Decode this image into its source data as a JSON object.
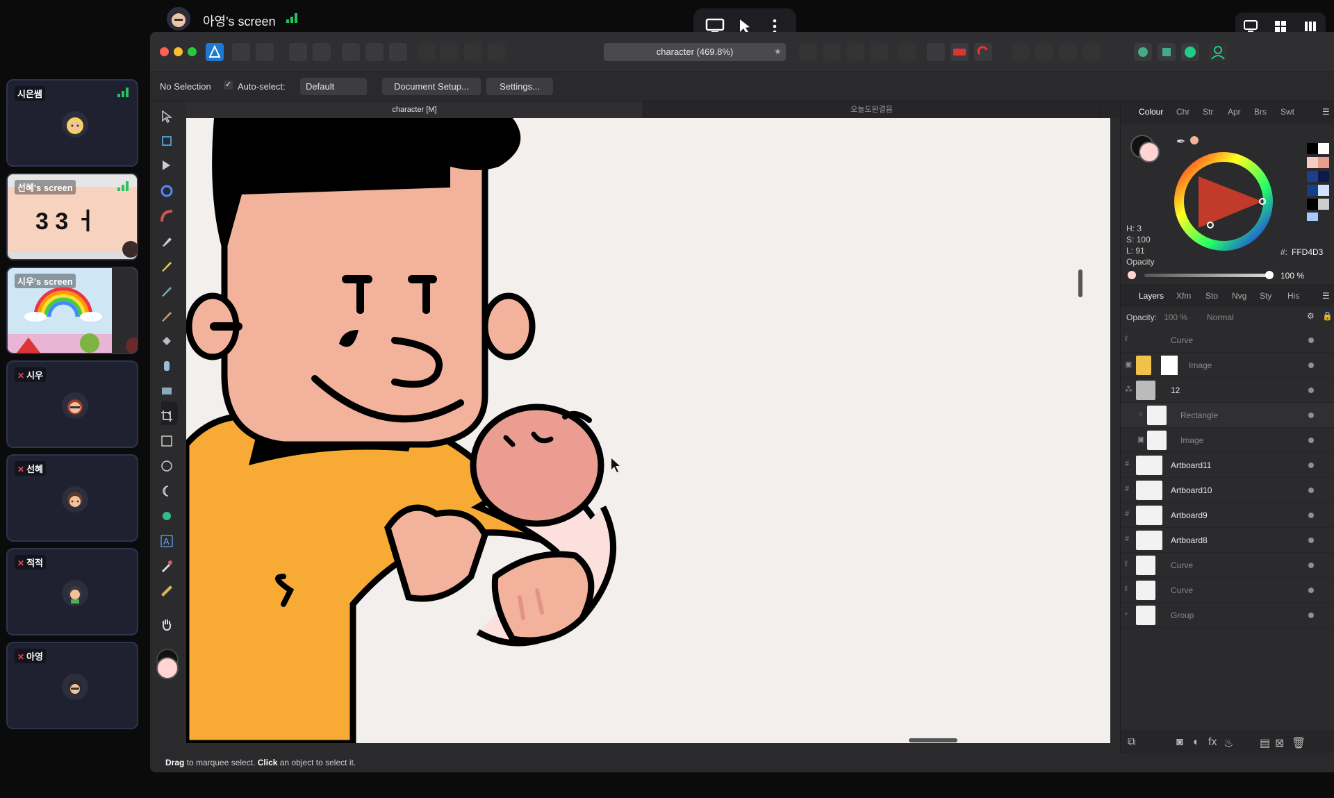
{
  "share": {
    "presenter": "아영's screen",
    "controls": [
      "screen-share-icon",
      "pointer-icon",
      "more-icon"
    ],
    "view_modes": [
      "screen-icon",
      "grid-icon",
      "sidebar-icon"
    ]
  },
  "participants": [
    {
      "name": "시은쌤",
      "muted": false,
      "kind": "avatar"
    },
    {
      "name": "선혜's screen",
      "muted": false,
      "kind": "screen",
      "preview_text": "3 3 ㅓ"
    },
    {
      "name": "시우's screen",
      "muted": false,
      "kind": "screen"
    },
    {
      "name": "시우",
      "muted": true,
      "kind": "avatar"
    },
    {
      "name": "선혜",
      "muted": true,
      "kind": "avatar"
    },
    {
      "name": "적적",
      "muted": true,
      "kind": "avatar"
    },
    {
      "name": "아영",
      "muted": true,
      "kind": "avatar"
    }
  ],
  "app": {
    "doc_title": "character (469.8%)",
    "context": {
      "selection": "No Selection",
      "auto_select_label": "Auto-select:",
      "auto_select_value": "Default",
      "document_setup": "Document Setup...",
      "settings": "Settings..."
    },
    "tabs": [
      "character [M]",
      "오늘도완결음"
    ],
    "status": {
      "drag": "Drag",
      "drag_rest": " to marquee select. ",
      "click": "Click",
      "click_rest": " an object to select it."
    }
  },
  "colour_panel": {
    "tabs": [
      "Colour",
      "Chr",
      "Str",
      "Apr",
      "Brs",
      "Swt"
    ],
    "h": "H: 3",
    "s": "S: 100",
    "l": "L: 91",
    "hex_label": "#:",
    "hex": "FFD4D3",
    "opacity_label": "Opacity",
    "opacity_value": "100 %",
    "fill_color": "#FFD4D3"
  },
  "layers_panel": {
    "tabs": [
      "Layers",
      "Xfm",
      "Sto",
      "Nvg",
      "Sty",
      "His"
    ],
    "opacity_label": "Opacity:",
    "opacity_value": "100 %",
    "blend": "Normal",
    "layers": [
      {
        "name": "Curve",
        "dim": true
      },
      {
        "name": "Image",
        "dim": true
      },
      {
        "name": "12",
        "dim": false
      },
      {
        "name": "Rectangle",
        "dim": true
      },
      {
        "name": "Image",
        "dim": true
      },
      {
        "name": "Artboard11",
        "dim": false
      },
      {
        "name": "Artboard10",
        "dim": false
      },
      {
        "name": "Artboard9",
        "dim": false
      },
      {
        "name": "Artboard8",
        "dim": false
      },
      {
        "name": "Curve",
        "dim": true
      },
      {
        "name": "Curve",
        "dim": true
      },
      {
        "name": "Group",
        "dim": true
      }
    ]
  }
}
